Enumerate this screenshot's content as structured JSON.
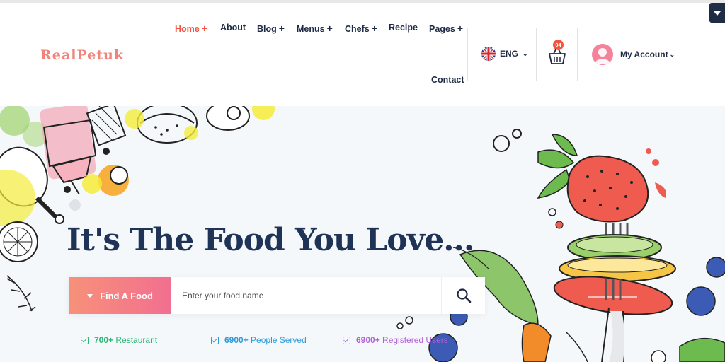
{
  "brand": {
    "logo": "RealPetuk"
  },
  "nav": {
    "items": [
      {
        "label": "Home",
        "suffix": "+"
      },
      {
        "label": "About",
        "suffix": ""
      },
      {
        "label": "Blog",
        "suffix": "+"
      },
      {
        "label": "Menus",
        "suffix": "+"
      },
      {
        "label": "Chefs",
        "suffix": "+"
      },
      {
        "label": "Recipe",
        "suffix": ""
      },
      {
        "label": "Pages",
        "suffix": "+"
      },
      {
        "label": "Contact",
        "suffix": ""
      }
    ]
  },
  "language": {
    "label": "ENG",
    "flag_icon": "uk-flag-icon"
  },
  "cart": {
    "count": "04",
    "icon": "basket-icon"
  },
  "account": {
    "label": "My Account",
    "icon": "avatar-icon"
  },
  "hero": {
    "headline": "It's The Food You Love...",
    "search": {
      "button_label": "Find A Food",
      "placeholder": "Enter your food name",
      "value": ""
    },
    "stats": [
      {
        "number": "700+",
        "label": "Restaurant",
        "color": "#2bb673"
      },
      {
        "number": "6900+",
        "label": "People Served",
        "color": "#2d9cdb"
      },
      {
        "number": "6900+",
        "label": "Registered Users",
        "color": "#b45fd6"
      }
    ]
  },
  "colors": {
    "accent": "#f1543f",
    "navy": "#1e3356",
    "corner_toggle": "#1f2d44"
  }
}
